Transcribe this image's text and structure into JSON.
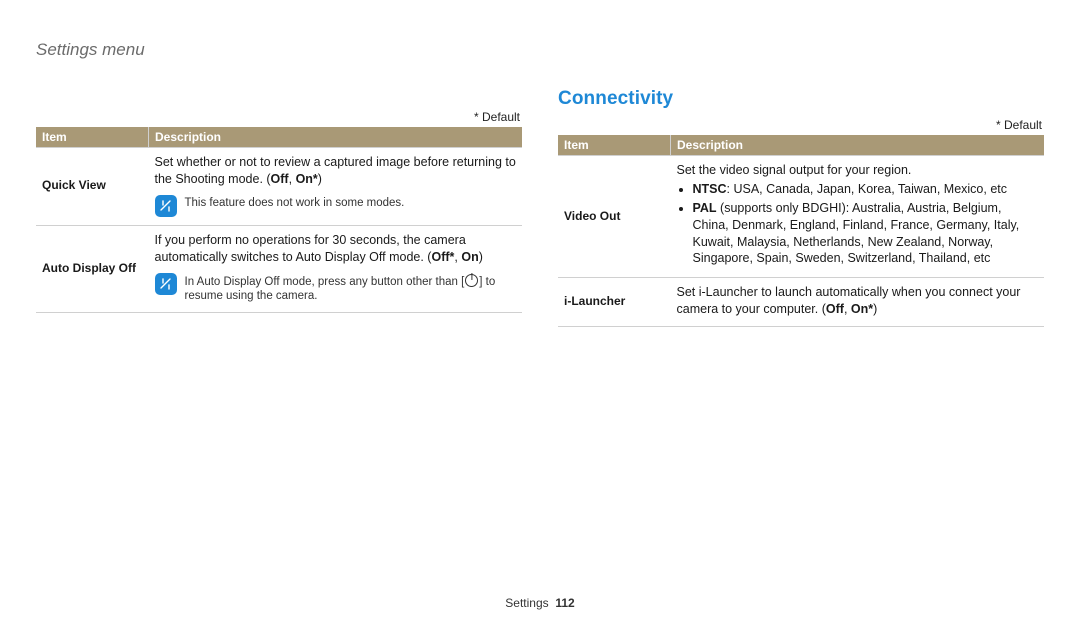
{
  "breadcrumb": "Settings menu",
  "default_marker": "* Default",
  "table_headers": {
    "item": "Item",
    "desc": "Description"
  },
  "left": {
    "rows": [
      {
        "item": "Quick View",
        "desc_pre": "Set whether or not to review a captured image before returning to the Shooting mode. (",
        "off": "Off",
        "sep": ", ",
        "on": "On*",
        "close": ")",
        "note": "This feature does not work in some modes."
      },
      {
        "item": "Auto Display Off",
        "desc_pre": "If you perform no operations for 30 seconds, the camera automatically switches to Auto Display Off mode. (",
        "off": "Off*",
        "sep": ", ",
        "on": "On",
        "close": ")",
        "note_pre": "In Auto Display Off mode, press any button other than [",
        "note_post": "] to resume using the camera."
      }
    ]
  },
  "right": {
    "section": "Connectivity",
    "rows": [
      {
        "item": "Video Out",
        "intro": "Set the video signal output for your region.",
        "bullets": [
          {
            "label": "NTSC",
            "text": ": USA, Canada, Japan, Korea, Taiwan, Mexico, etc"
          },
          {
            "label": "PAL",
            "extra": " (supports only BDGHI)",
            "text": ": Australia, Austria, Belgium, China, Denmark, England, Finland, France, Germany, Italy, Kuwait, Malaysia, Netherlands, New Zealand, Norway, Singapore, Spain, Sweden, Switzerland, Thailand, etc"
          }
        ]
      },
      {
        "item": "i-Launcher",
        "desc_pre": "Set i-Launcher to launch automatically when you connect your camera to your computer. (",
        "off": "Off",
        "sep": ", ",
        "on": "On*",
        "close": ")"
      }
    ]
  },
  "footer": {
    "section": "Settings",
    "page": "112"
  }
}
